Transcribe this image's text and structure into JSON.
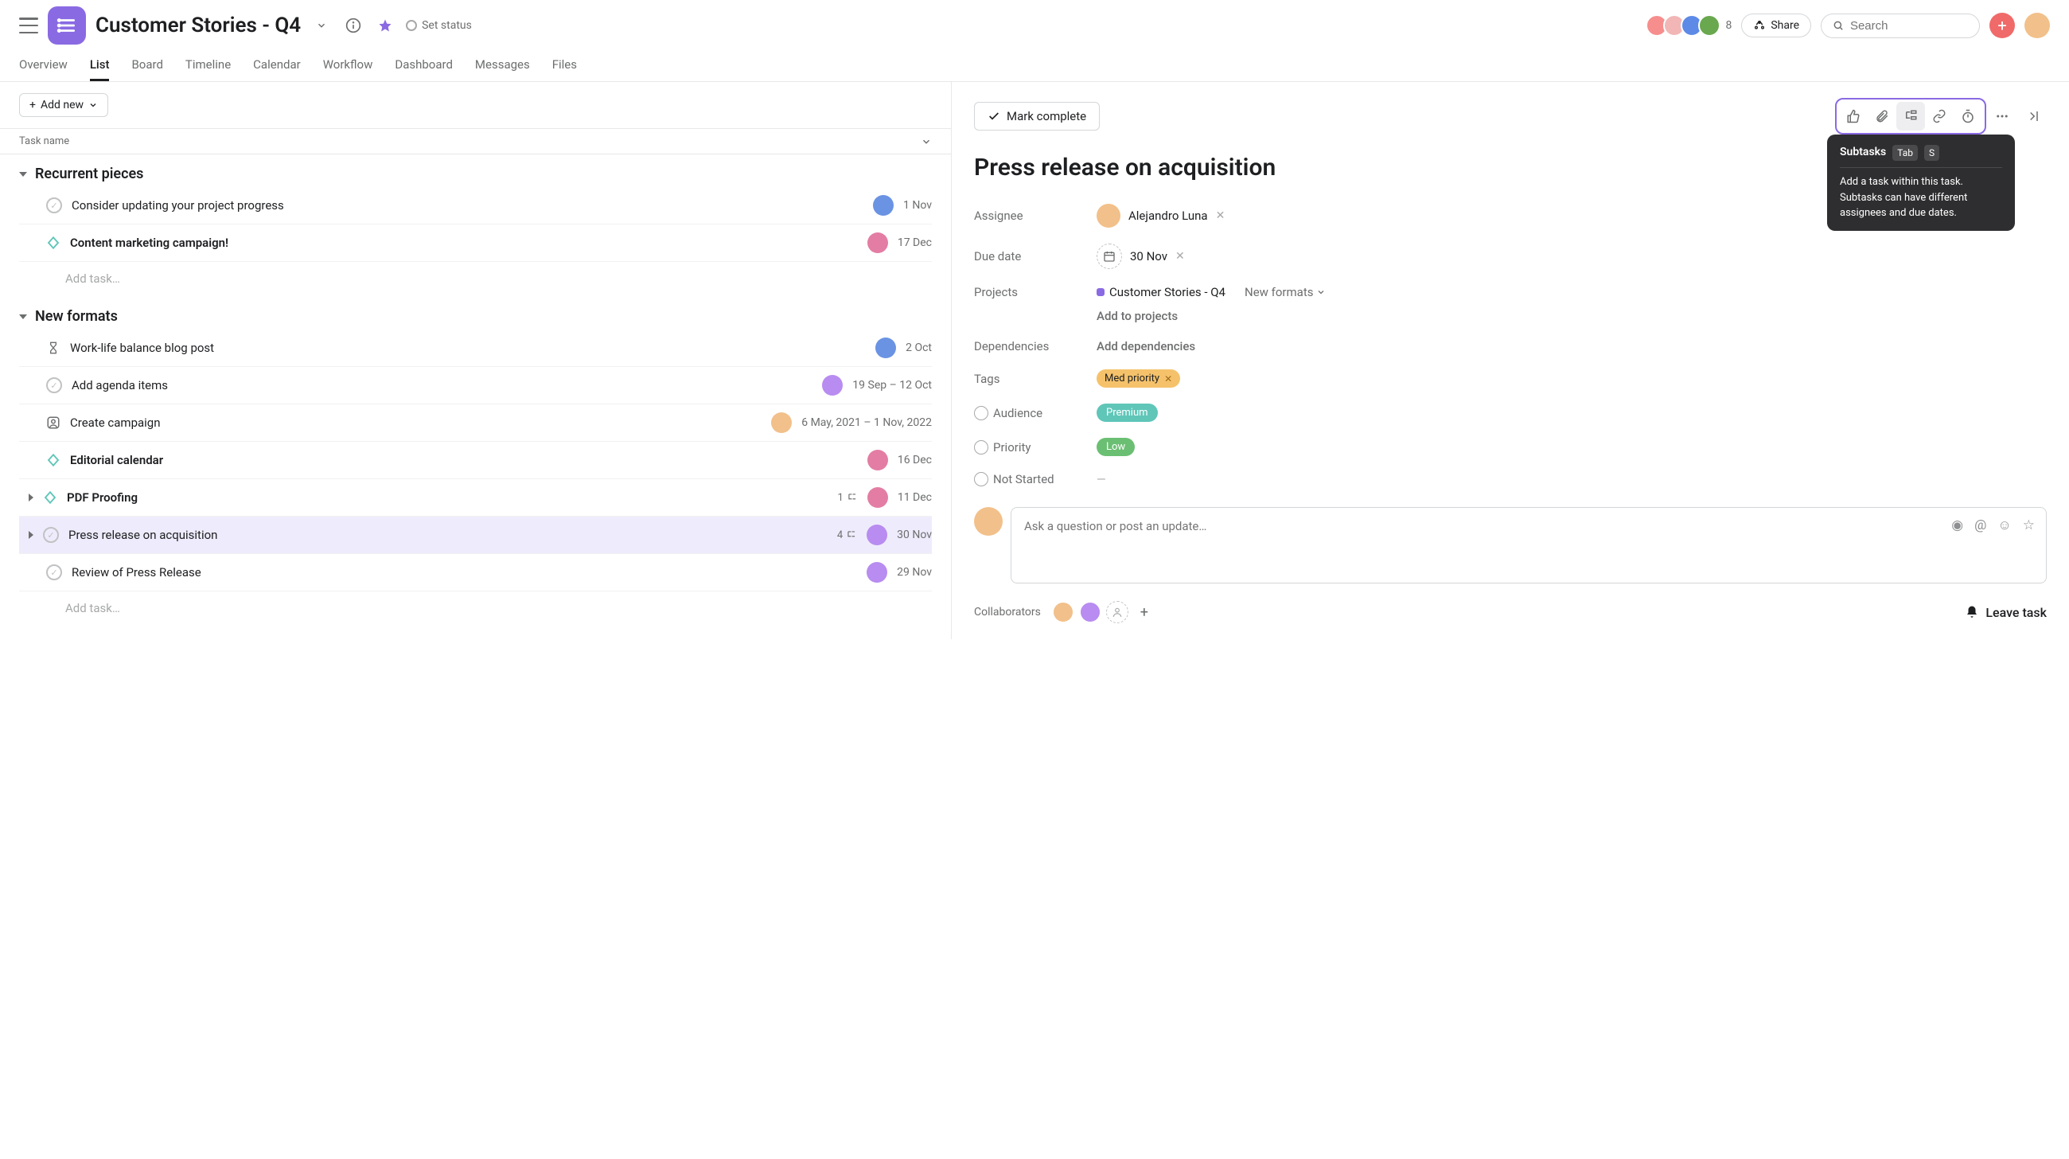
{
  "header": {
    "project_title": "Customer Stories - Q4",
    "set_status": "Set status",
    "member_count": "8",
    "share": "Share",
    "search_placeholder": "Search"
  },
  "tabs": [
    "Overview",
    "List",
    "Board",
    "Timeline",
    "Calendar",
    "Workflow",
    "Dashboard",
    "Messages",
    "Files"
  ],
  "left": {
    "add_new": "Add new",
    "col_name": "Task name",
    "sections": [
      {
        "name": "Recurrent pieces",
        "tasks": [
          {
            "icon": "ck",
            "name": "Consider updating your project progress",
            "bold": false,
            "date": "1 Nov",
            "av": "a"
          },
          {
            "icon": "hex",
            "name": "Content marketing campaign!",
            "bold": true,
            "date": "17 Dec",
            "av": "b"
          }
        ],
        "add": "Add task…"
      },
      {
        "name": "New formats",
        "tasks": [
          {
            "icon": "hourglass",
            "name": "Work-life balance blog post",
            "bold": false,
            "date": "2 Oct",
            "av": "a"
          },
          {
            "icon": "ck",
            "name": "Add agenda items",
            "bold": false,
            "date": "19 Sep – 12 Oct",
            "av": "c"
          },
          {
            "icon": "approval",
            "name": "Create campaign",
            "bold": false,
            "date": "6 May, 2021 – 1 Nov, 2022",
            "av": "d"
          },
          {
            "icon": "hex",
            "name": "Editorial calendar",
            "bold": true,
            "date": "16 Dec",
            "av": "b"
          },
          {
            "icon": "hex",
            "name": "PDF Proofing",
            "bold": true,
            "date": "11 Dec",
            "av": "b",
            "sub": "1",
            "expand": true
          },
          {
            "icon": "ck",
            "name": "Press release on acquisition",
            "bold": false,
            "date": "30 Nov",
            "av": "e",
            "sub": "4",
            "selected": true,
            "expand": true
          },
          {
            "icon": "ck",
            "name": "Review of Press Release",
            "bold": false,
            "date": "29 Nov",
            "av": "e"
          }
        ],
        "add": "Add task…"
      }
    ]
  },
  "right": {
    "mark_complete": "Mark complete",
    "title": "Press release on acquisition",
    "tooltip_title": "Subtasks",
    "tooltip_k1": "Tab",
    "tooltip_k2": "S",
    "tooltip_body": "Add a task within this task. Subtasks can have different assignees and due dates.",
    "fields": {
      "assignee_label": "Assignee",
      "assignee_name": "Alejandro Luna",
      "duedate_label": "Due date",
      "duedate_val": "30 Nov",
      "projects_label": "Projects",
      "projects_name": "Customer Stories - Q4",
      "projects_section": "New formats",
      "add_to_projects": "Add to projects",
      "deps_label": "Dependencies",
      "add_deps": "Add dependencies",
      "tags_label": "Tags",
      "tag_val": "Med priority",
      "audience_label": "Audience",
      "audience_val": "Premium",
      "priority_label": "Priority",
      "priority_val": "Low",
      "notstarted_label": "Not Started",
      "notstarted_val": "—"
    },
    "comment_placeholder": "Ask a question or post an update…",
    "collaborators_label": "Collaborators",
    "leave_task": "Leave task"
  }
}
